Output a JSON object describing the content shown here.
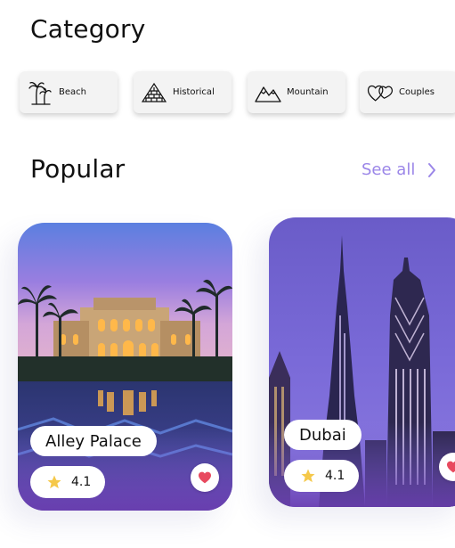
{
  "category": {
    "title": "Category",
    "items": [
      {
        "label": "Beach",
        "icon": "palm-tree-icon"
      },
      {
        "label": "Historical",
        "icon": "pyramid-icon"
      },
      {
        "label": "Mountain",
        "icon": "mountain-icon"
      },
      {
        "label": "Couples",
        "icon": "hearts-icon"
      }
    ]
  },
  "popular": {
    "title": "Popular",
    "see_all_label": "See all",
    "see_all_color": "#9b86e8",
    "places": [
      {
        "name": "Alley Palace",
        "rating": "4.1",
        "favorite_icon": "heart-icon",
        "rating_icon": "star-icon"
      },
      {
        "name": "Dubai",
        "rating": "4.1",
        "favorite_icon": "heart-icon",
        "rating_icon": "star-icon"
      }
    ]
  },
  "colors": {
    "accent": "#9b86e8",
    "heart": "#e84a5f",
    "star": "#f5c84a"
  }
}
